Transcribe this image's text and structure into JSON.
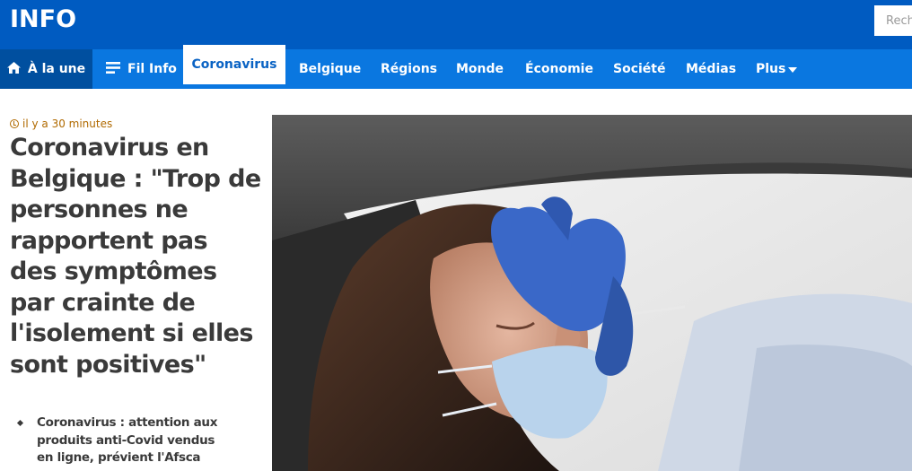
{
  "header": {
    "brand": "INFO",
    "search_placeholder": "Rechercher"
  },
  "nav": {
    "home": "À la une",
    "filinfo": "Fil Info",
    "items": [
      "Coronavirus",
      "Belgique",
      "Régions",
      "Monde",
      "Économie",
      "Société",
      "Médias",
      "Plus"
    ]
  },
  "article": {
    "time": "il y a 30 minutes",
    "headline": "Coronavirus en Belgique : \"Trop de personnes ne rapportent pas des symptômes par crainte de l'isolement si elles sont positives\"",
    "related": [
      "Coronavirus : attention aux produits anti-Covid vendus en ligne, prévient l'Afsca"
    ]
  },
  "colors": {
    "topbar": "#005bc1",
    "navbar": "#0a77e0",
    "home_tab": "#004f9f",
    "time_accent": "#b06a00"
  },
  "icons": {
    "home": "home-icon",
    "list": "list-icon",
    "clock": "clock-icon",
    "caret": "caret-down-icon"
  }
}
